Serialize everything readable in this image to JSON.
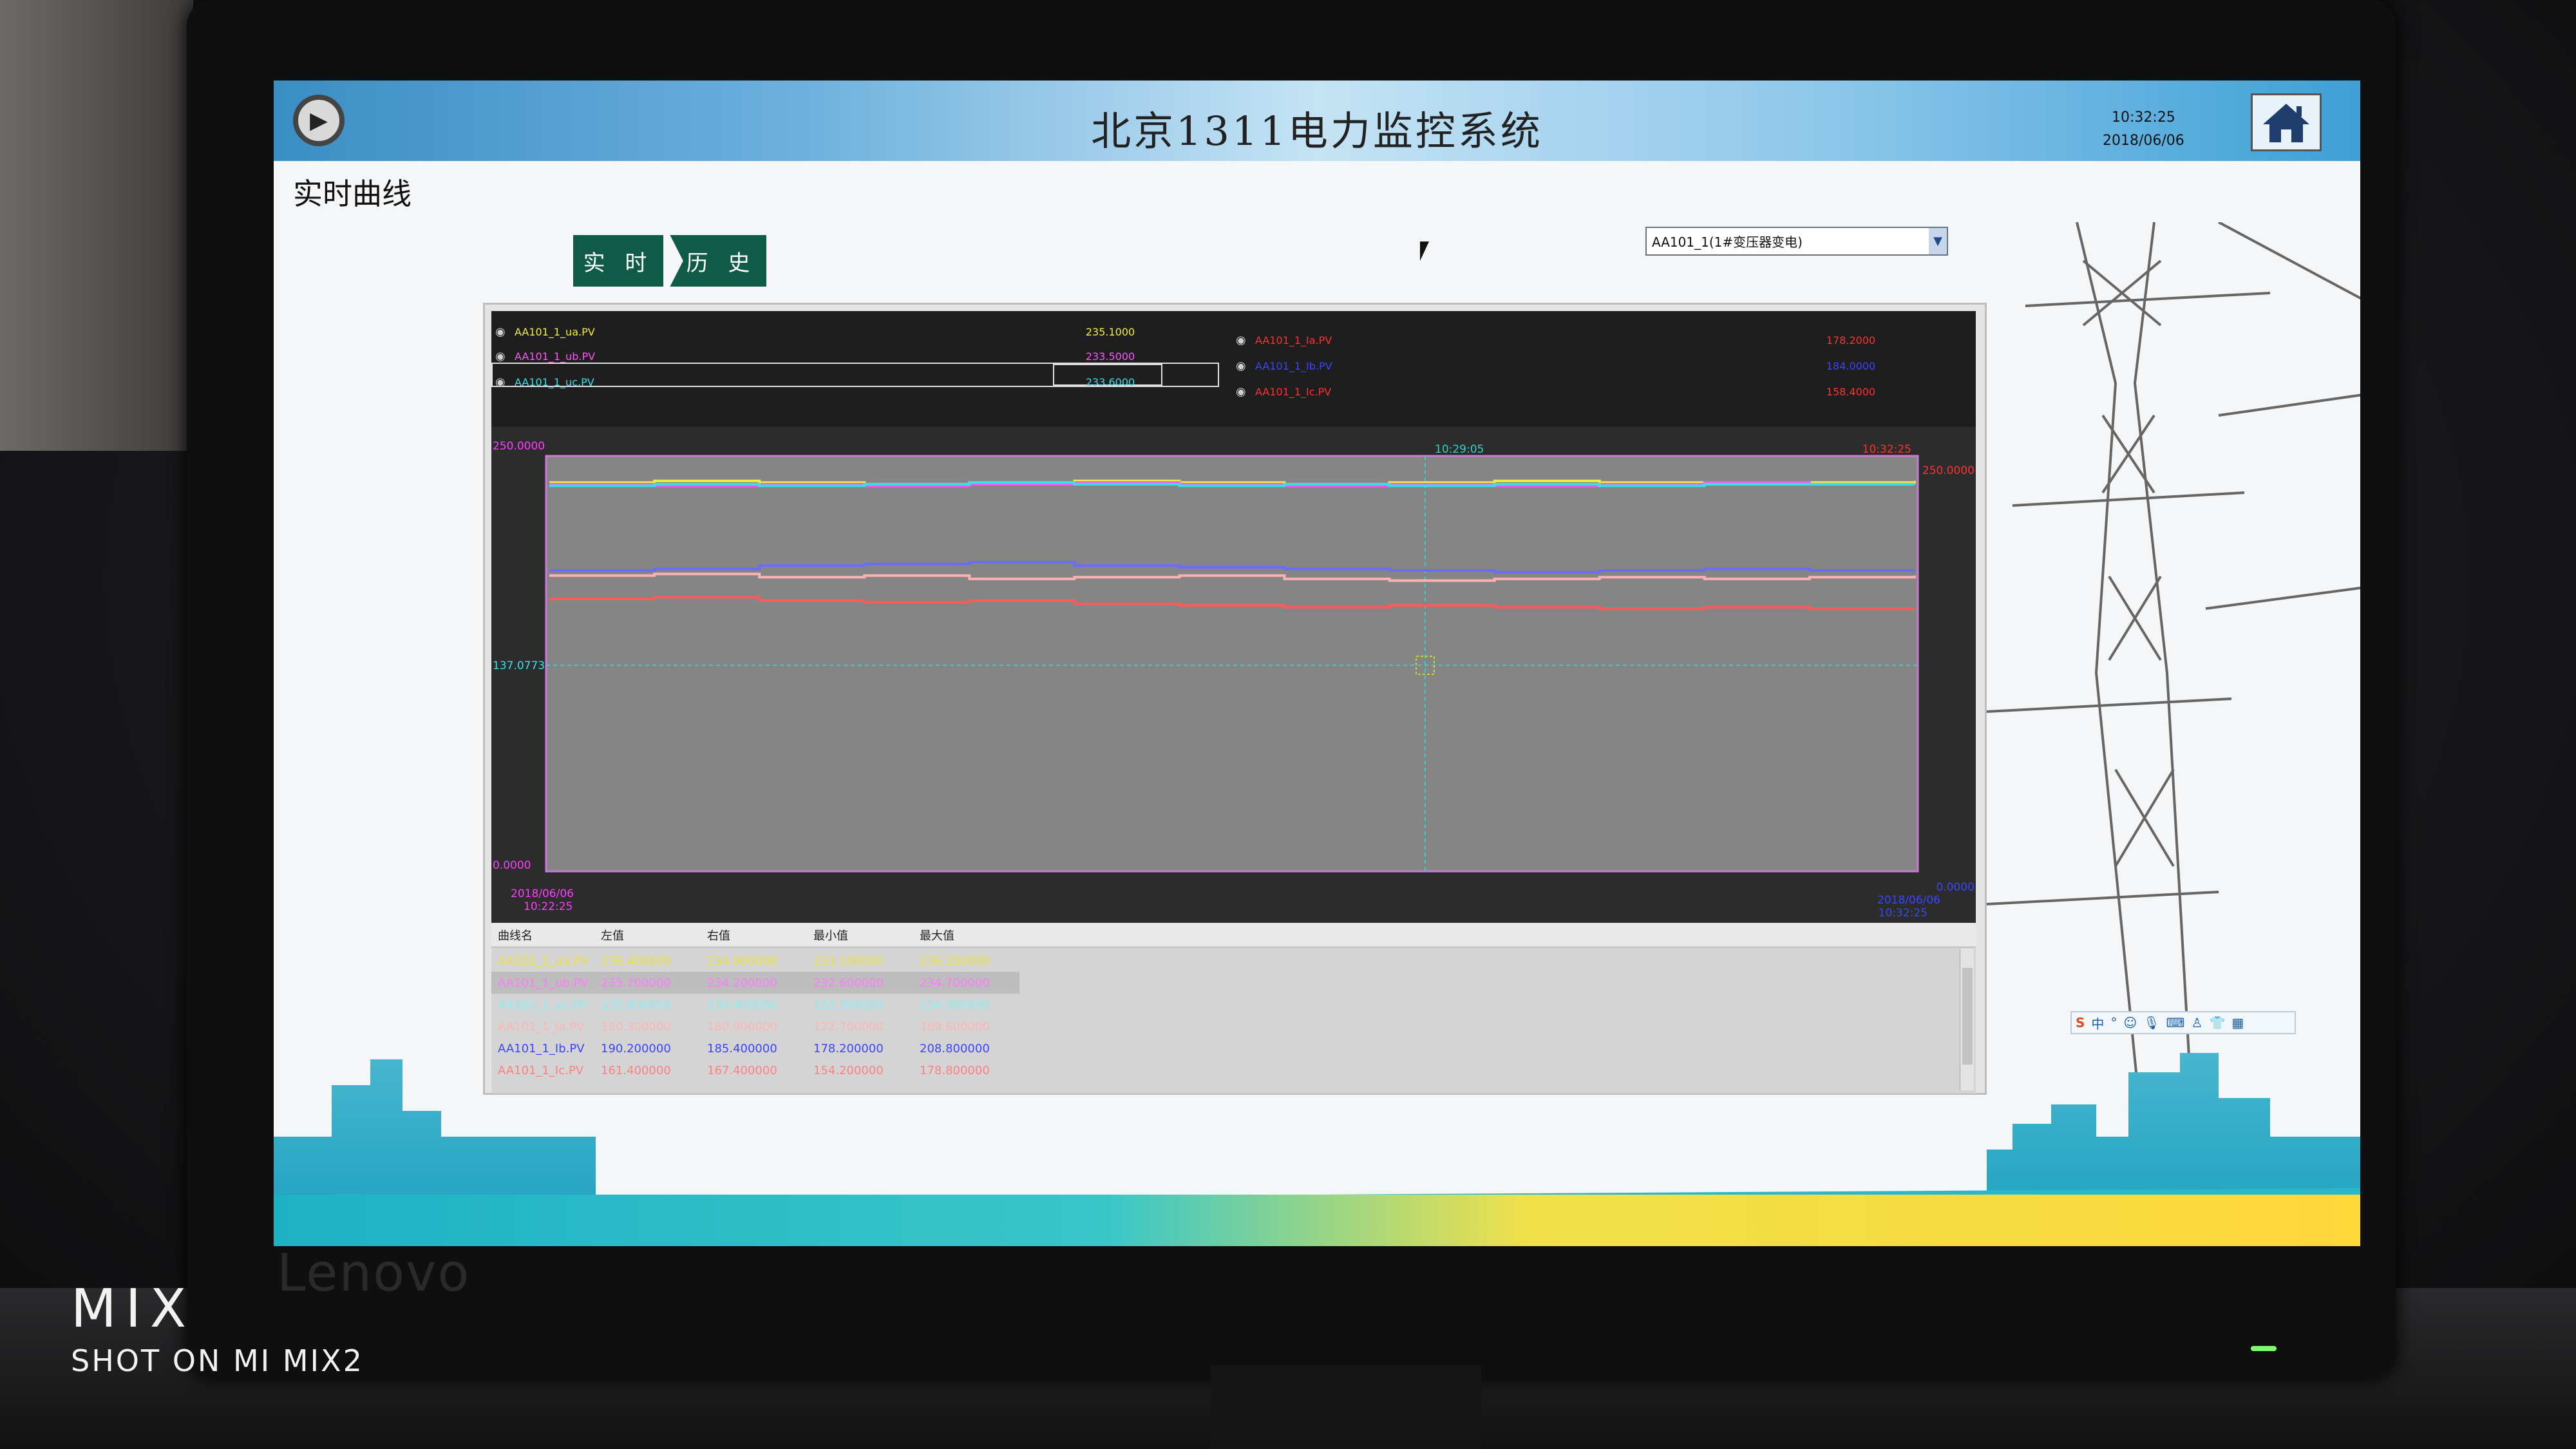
{
  "watermark": {
    "main": "MIX",
    "sub": "SHOT ON MI MIX2"
  },
  "monitor_brand": "Lenovo",
  "header": {
    "title": "北京1311电力监控系统",
    "time": "10:32:25",
    "date": "2018/06/06"
  },
  "page_title": "实时曲线",
  "mode_buttons": {
    "realtime": "实 时",
    "history": "历 史"
  },
  "curve_select": {
    "value": "AA101_1(1#变压器变电)"
  },
  "legend": [
    {
      "name": "AA101_1_ua.PV",
      "value": "235.1000",
      "color": "#f2ec3a"
    },
    {
      "name": "AA101_1_ub.PV",
      "value": "233.5000",
      "color": "#ff53ff"
    },
    {
      "name": "AA101_1_uc.PV",
      "value": "233.6000",
      "color": "#35e0e6"
    },
    {
      "name": "AA101_1_Ia.PV",
      "value": "178.2000",
      "color": "#ff3030"
    },
    {
      "name": "AA101_1_Ib.PV",
      "value": "184.0000",
      "color": "#3a45ff"
    },
    {
      "name": "AA101_1_Ic.PV",
      "value": "158.4000",
      "color": "#ff3030"
    }
  ],
  "chart_labels": {
    "y_top_left": "250.0000",
    "y_mid_left": "137.0773",
    "y_bottom_left": "0.0000",
    "y_top_right": "250.0000",
    "y_bottom_right": "0.0000",
    "cursor_time": "10:29:05",
    "top_right_time": "10:32:25",
    "start_date": "2018/06/06",
    "start_time": "10:22:25",
    "end_date": "2018/06/06",
    "end_time": "10:32:25"
  },
  "chart_data": {
    "type": "line",
    "ylim": [
      0,
      250
    ],
    "x": [
      "10:22:25",
      "10:32:25"
    ],
    "series": [
      {
        "name": "AA101_1_ua.PV",
        "color": "#f2ec3a",
        "values": [
          234,
          235,
          234,
          233,
          234,
          235,
          234,
          233,
          234,
          235,
          234,
          233,
          234,
          235
        ]
      },
      {
        "name": "AA101_1_ub.PV",
        "color": "#ff53ff",
        "values": [
          233,
          232,
          233,
          232,
          233,
          234,
          233,
          232,
          233,
          232,
          233,
          234,
          233,
          233
        ]
      },
      {
        "name": "AA101_1_uc.PV",
        "color": "#35e0e6",
        "values": [
          232,
          233,
          232,
          233,
          234,
          233,
          232,
          233,
          232,
          233,
          232,
          233,
          233,
          233
        ]
      },
      {
        "name": "AA101_1_Ia.PV",
        "color": "#ffb0b0",
        "values": [
          178,
          179,
          177,
          178,
          176,
          177,
          178,
          176,
          175,
          176,
          177,
          176,
          177,
          178
        ]
      },
      {
        "name": "AA101_1_Ib.PV",
        "color": "#6a6cff",
        "values": [
          181,
          182,
          184,
          185,
          186,
          184,
          183,
          182,
          181,
          180,
          181,
          182,
          181,
          181
        ]
      },
      {
        "name": "AA101_1_Ic.PV",
        "color": "#ff5a5a",
        "values": [
          164,
          165,
          163,
          162,
          163,
          161,
          160,
          159,
          160,
          159,
          158,
          159,
          158,
          158
        ]
      }
    ]
  },
  "table": {
    "headers": [
      "曲线名",
      "左值",
      "右值",
      "最小值",
      "最大值"
    ],
    "rows": [
      {
        "cells": [
          "AA101_1_ua.PV",
          "236.400000",
          "234.900000",
          "233.100000",
          "236.200000"
        ],
        "color": "#e8e23a"
      },
      {
        "cells": [
          "AA101_1_ub.PV",
          "235.700000",
          "234.200000",
          "232.600000",
          "234.700000"
        ],
        "color": "#ff7bff"
      },
      {
        "cells": [
          "AA101_1_uc.PV",
          "235.800000",
          "234.400000",
          "232.300000",
          "234.900000"
        ],
        "color": "#8aeef2"
      },
      {
        "cells": [
          "AA101_1_Ia.PV",
          "180.300000",
          "180.900000",
          "172.700000",
          "189.600000"
        ],
        "color": "#ffb5b5"
      },
      {
        "cells": [
          "AA101_1_Ib.PV",
          "190.200000",
          "185.400000",
          "178.200000",
          "208.800000"
        ],
        "color": "#3a45ff"
      },
      {
        "cells": [
          "AA101_1_Ic.PV",
          "161.400000",
          "167.400000",
          "154.200000",
          "178.800000"
        ],
        "color": "#ff8080"
      }
    ]
  },
  "ime": {
    "s": "S",
    "zh": "中",
    "punct": "°",
    "smile": "☺",
    "mic": "🎙",
    "kb": "⌨",
    "user": "♙",
    "shirt": "👕",
    "grid": "▦"
  }
}
